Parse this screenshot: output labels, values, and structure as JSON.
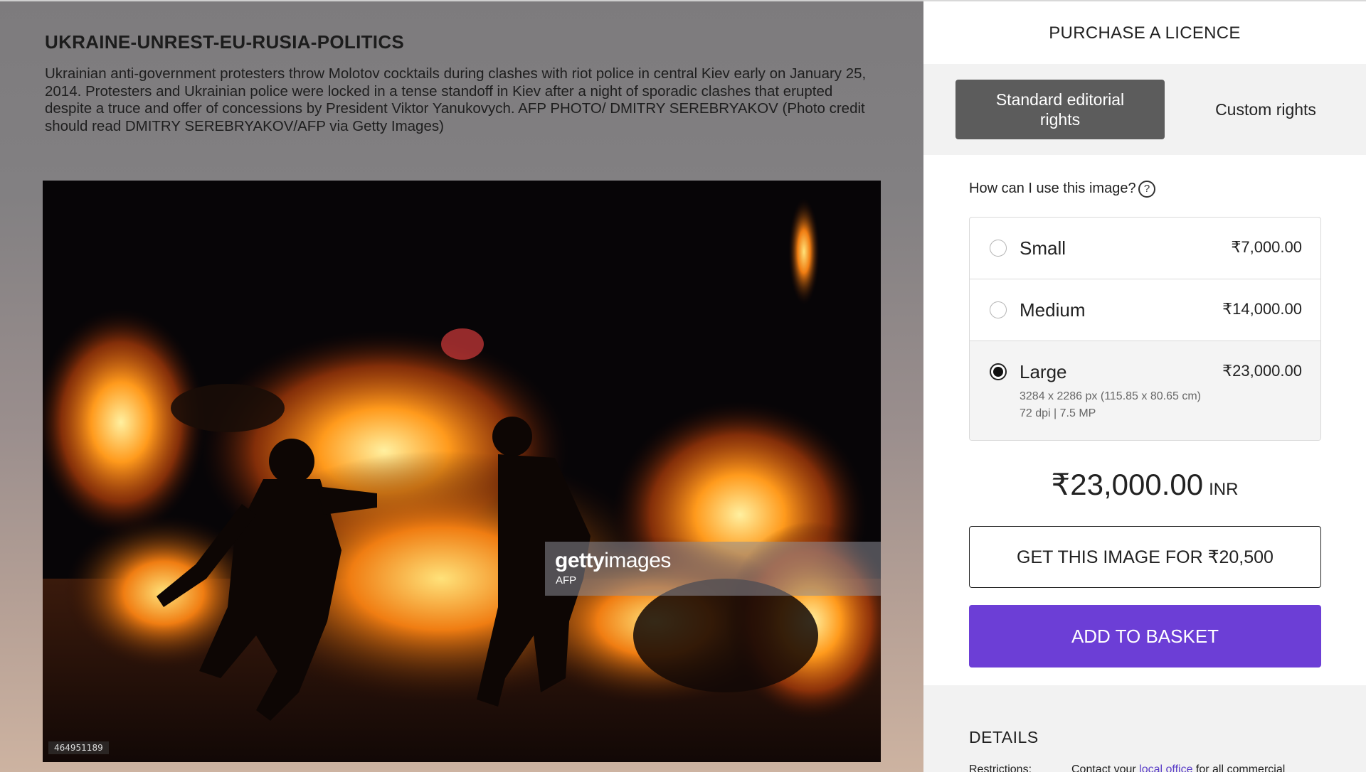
{
  "photo": {
    "title": "UKRAINE-UNREST-EU-RUSIA-POLITICS",
    "caption": "Ukrainian anti-government protesters throw Molotov cocktails during clashes with riot police in central Kiev early on January 25, 2014. Protesters and Ukrainian police were locked in a tense standoff in Kiev after a night of sporadic clashes that erupted despite a truce and offer of concessions by President Viktor Yanukovych. AFP PHOTO/ DMITRY SEREBRYAKOV (Photo credit should read DMITRY SEREBRYAKOV/AFP via Getty Images)",
    "watermark_brand_bold": "getty",
    "watermark_brand_light": "images",
    "watermark_agency": "AFP",
    "image_id": "464951189"
  },
  "licence": {
    "header": "PURCHASE A LICENCE",
    "tabs": [
      {
        "label": "Standard editorial rights",
        "selected": true
      },
      {
        "label": "Custom rights",
        "selected": false
      }
    ],
    "usage_question": "How can I use this image?",
    "help_icon": "?",
    "sizes": [
      {
        "name": "Small",
        "price": "₹7,000.00",
        "selected": false
      },
      {
        "name": "Medium",
        "price": "₹14,000.00",
        "selected": false
      },
      {
        "name": "Large",
        "price": "₹23,000.00",
        "selected": true,
        "dimensions": "3284 x 2286 px (115.85 x 80.65 cm)",
        "resolution": "72 dpi | 7.5 MP"
      }
    ],
    "total_amount": "₹23,000.00",
    "total_currency": "INR",
    "get_image_label": "GET THIS IMAGE FOR ₹20,500",
    "add_to_basket_label": "ADD TO BASKET"
  },
  "details": {
    "heading": "DETAILS",
    "restrictions_label": "Restrictions:",
    "restrictions_prefix": "Contact your ",
    "restrictions_link": "local office",
    "restrictions_suffix": " for all commercial"
  },
  "colors": {
    "accent_purple": "#6c3ed6",
    "selected_tab": "#5c5c5c",
    "link": "#5b3fc8"
  }
}
